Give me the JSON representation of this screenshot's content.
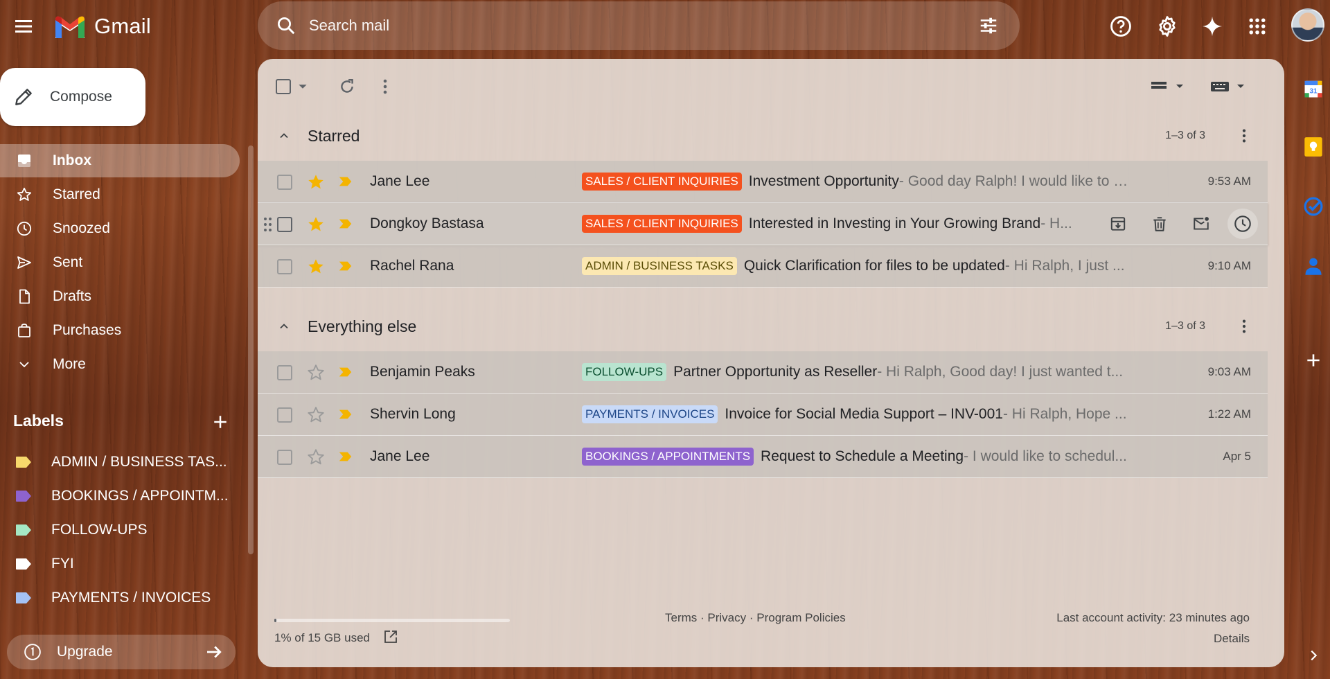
{
  "app": {
    "name": "Gmail"
  },
  "search": {
    "placeholder": "Search mail"
  },
  "sidebar": {
    "compose_label": "Compose",
    "nav": [
      {
        "label": "Inbox",
        "icon": "inbox-icon",
        "active": true
      },
      {
        "label": "Starred",
        "icon": "star-icon"
      },
      {
        "label": "Snoozed",
        "icon": "clock-icon"
      },
      {
        "label": "Sent",
        "icon": "send-icon"
      },
      {
        "label": "Drafts",
        "icon": "draft-icon"
      },
      {
        "label": "Purchases",
        "icon": "bag-icon"
      },
      {
        "label": "More",
        "icon": "chevron-down-icon"
      }
    ],
    "labels_title": "Labels",
    "labels": [
      {
        "label": "ADMIN / BUSINESS TAS...",
        "color": "#f7d96c"
      },
      {
        "label": "BOOKINGS / APPOINTM...",
        "color": "#8e63ce"
      },
      {
        "label": "FOLLOW-UPS",
        "color": "#a5e8c4"
      },
      {
        "label": "FYI",
        "color": "#ffffff"
      },
      {
        "label": "PAYMENTS / INVOICES",
        "color": "#a4c2f4"
      }
    ],
    "upgrade_label": "Upgrade"
  },
  "sections": [
    {
      "title": "Starred",
      "count": "1–3 of 3",
      "rows": [
        {
          "sender": "Jane Lee",
          "label": "SALES / CLIENT INQUIRIES",
          "label_bg": "#f4511e",
          "label_fg": "#ffffff",
          "subject": "Investment Opportunity",
          "snippet": " - Good day Ralph! I would like to r...",
          "time": "9:53 AM",
          "starred": true
        },
        {
          "sender": "Dongkoy Bastasa",
          "label": "SALES / CLIENT INQUIRIES",
          "label_bg": "#f4511e",
          "label_fg": "#ffffff",
          "subject": "Interested in Investing in Your Growing Brand",
          "snippet": " - H...",
          "time": "",
          "starred": true,
          "hovered": true
        },
        {
          "sender": "Rachel Rana",
          "label": "ADMIN / BUSINESS TASKS",
          "label_bg": "#fce8b2",
          "label_fg": "#594c05",
          "subject": "Quick Clarification for files to be updated",
          "snippet": " - Hi Ralph, I just ...",
          "time": "9:10 AM",
          "starred": true
        }
      ]
    },
    {
      "title": "Everything else",
      "count": "1–3 of 3",
      "rows": [
        {
          "sender": "Benjamin Peaks",
          "label": "FOLLOW-UPS",
          "label_bg": "#b9e4d0",
          "label_fg": "#0b4f30",
          "subject": "Partner Opportunity as Reseller",
          "snippet": " - Hi Ralph, Good day! I just wanted t...",
          "time": "9:03 AM",
          "starred": false
        },
        {
          "sender": "Shervin Long",
          "label": "PAYMENTS / INVOICES",
          "label_bg": "#c9daf8",
          "label_fg": "#1c4587",
          "subject": "Invoice for Social Media Support – INV-001",
          "snippet": " - Hi Ralph, Hope ...",
          "time": "1:22 AM",
          "starred": false
        },
        {
          "sender": "Jane Lee",
          "label": "BOOKINGS / APPOINTMENTS",
          "label_bg": "#8e63ce",
          "label_fg": "#ffffff",
          "subject": "Request to Schedule a Meeting",
          "snippet": " - I would like to schedul...",
          "time": "Apr 5",
          "starred": false
        }
      ]
    }
  ],
  "footer": {
    "storage": "1% of 15 GB used",
    "storage_percent": 1,
    "terms": "Terms",
    "privacy": "Privacy",
    "policies": "Program Policies",
    "sep": " · ",
    "activity": "Last account activity: 23 minutes ago",
    "details": "Details"
  },
  "colors": {
    "star": "#f4b400",
    "important": "#f4b400"
  }
}
